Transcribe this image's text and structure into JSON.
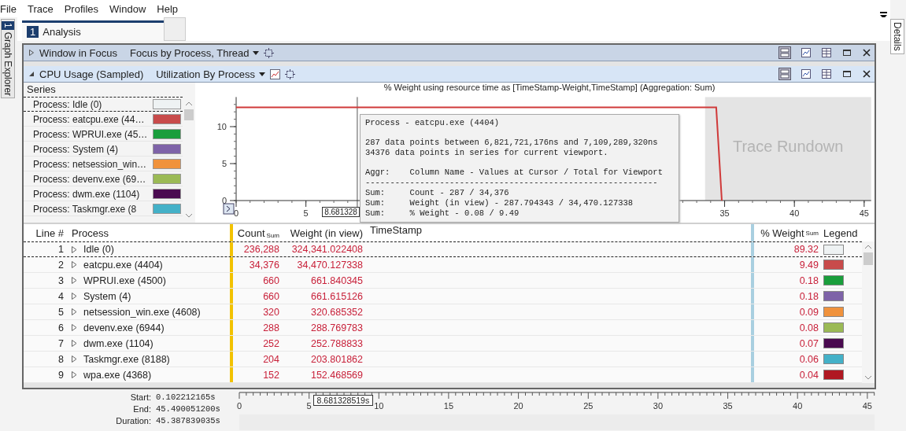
{
  "menu": [
    "File",
    "Trace",
    "Profiles",
    "Window",
    "Help"
  ],
  "left_tab": {
    "number": "1",
    "label": "Graph Explorer"
  },
  "right_tab": {
    "label": "Details"
  },
  "doc_tabs": [
    {
      "number": "1",
      "label": "Analysis",
      "selected": true
    }
  ],
  "panels": [
    {
      "title": "Window in Focus",
      "preset": "Focus by Process, Thread",
      "expanded": false
    },
    {
      "title": "CPU Usage (Sampled)",
      "preset": "Utilization By Process",
      "expanded": true
    }
  ],
  "series_list": {
    "heading": "Series",
    "items": [
      {
        "label": "Process: Idle (0)",
        "color": "#eef2f3",
        "selected": true
      },
      {
        "label": "Process: eatcpu.exe (44…",
        "color": "#c84b4b",
        "selected": false
      },
      {
        "label": "Process: WPRUI.exe (45…",
        "color": "#1a9e3c",
        "selected": false
      },
      {
        "label": "Process: System (4)",
        "color": "#7e63a8",
        "selected": false
      },
      {
        "label": "Process: netsession_win…",
        "color": "#f0923c",
        "selected": false
      },
      {
        "label": "Process: devenv.exe (69…",
        "color": "#9bba55",
        "selected": false
      },
      {
        "label": "Process: dwm.exe (1104)",
        "color": "#4a0a50",
        "selected": false
      },
      {
        "label": "Process: Taskmgr.exe (8",
        "color": "#44b1c8",
        "selected": false
      }
    ]
  },
  "chart": {
    "chart_data": {
      "type": "line",
      "title": "% Weight using resource time as [TimeStamp-Weight,TimeStamp] (Aggregation: Sum)",
      "x": [
        0,
        34.4,
        34.8
      ],
      "series": [
        {
          "color": "#d03a3a",
          "values": [
            12.6,
            12.6,
            0
          ]
        }
      ],
      "xlim": [
        0,
        45.5
      ],
      "ylim": [
        0,
        14
      ],
      "xticks": [
        0,
        5,
        35,
        40,
        45
      ],
      "yticks": [
        0,
        5,
        10
      ]
    },
    "rundown_label": "Trace Rundown",
    "cursor_label": "8.681328",
    "tooltip": [
      [
        "Process - eatcpu.exe (4404)"
      ],
      [
        "287 data points between 6,821,721,176ns and 7,109,289,320ns",
        "34376 data points in series for current viewport."
      ],
      [
        "Aggr:    Column Name - Values at Cursor / Total for Viewport",
        "-----------------------------------------------------------",
        "Sum:     Count - 287 / 34,376",
        "Sum:     Weight (in view) - 287.794343 / 34,470.127338",
        "Sum:     % Weight - 0.08 / 9.49"
      ]
    ]
  },
  "table": {
    "columns": [
      {
        "label": "Line #"
      },
      {
        "label": "Process"
      },
      {
        "label": "Count",
        "aggregation": "Sum"
      },
      {
        "label": "Weight (in view)"
      },
      {
        "label": "TimeStamp"
      },
      {
        "label": "% Weight",
        "aggregation": "Sum"
      },
      {
        "label": "Legend"
      }
    ],
    "rows": [
      {
        "line": "1",
        "process": "Idle (0)",
        "count": "236,288",
        "weight": "324,341.022408",
        "percent": "89.32",
        "color": "#eef2f3",
        "selected": true
      },
      {
        "line": "2",
        "process": "eatcpu.exe (4404)",
        "count": "34,376",
        "weight": "34,470.127338",
        "percent": "9.49",
        "color": "#c84b4b",
        "selected": false
      },
      {
        "line": "3",
        "process": "WPRUI.exe (4500)",
        "count": "660",
        "weight": "661.840345",
        "percent": "0.18",
        "color": "#1a9e3c",
        "selected": false
      },
      {
        "line": "4",
        "process": "System (4)",
        "count": "660",
        "weight": "661.615126",
        "percent": "0.18",
        "color": "#7e63a8",
        "selected": false
      },
      {
        "line": "5",
        "process": "netsession_win.exe (4608)",
        "count": "320",
        "weight": "320.685352",
        "percent": "0.09",
        "color": "#f0923c",
        "selected": false
      },
      {
        "line": "6",
        "process": "devenv.exe (6944)",
        "count": "288",
        "weight": "288.769783",
        "percent": "0.08",
        "color": "#9bba55",
        "selected": false
      },
      {
        "line": "7",
        "process": "dwm.exe (1104)",
        "count": "252",
        "weight": "252.788833",
        "percent": "0.07",
        "color": "#4a0a50",
        "selected": false
      },
      {
        "line": "8",
        "process": "Taskmgr.exe (8188)",
        "count": "204",
        "weight": "203.801862",
        "percent": "0.06",
        "color": "#44b1c8",
        "selected": false
      },
      {
        "line": "9",
        "process": "wpa.exe (4368)",
        "count": "152",
        "weight": "152.468569",
        "percent": "0.04",
        "color": "#b01822",
        "selected": false
      }
    ]
  },
  "timeline": {
    "rows": [
      {
        "label": "Start:",
        "value": "0.102212165s"
      },
      {
        "label": "End:",
        "value": "45.490051200s"
      },
      {
        "label": "Duration:",
        "value": "45.387839035s"
      }
    ],
    "ticks": [
      "0",
      "5",
      "10",
      "15",
      "20",
      "25",
      "30",
      "35",
      "40",
      "45"
    ],
    "cursor": "8.681328519s"
  }
}
